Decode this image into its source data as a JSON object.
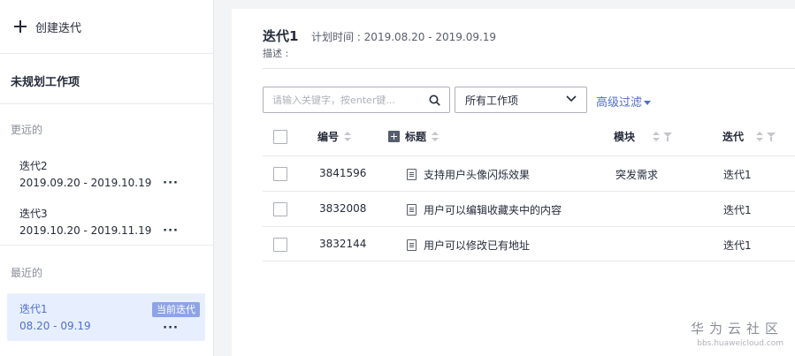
{
  "sidebar": {
    "create_label": "创建迭代",
    "unplanned_label": "未规划工作项",
    "farther_label": "更远的",
    "recent_label": "最近的",
    "farther_items": [
      {
        "name": "迭代2",
        "date": "2019.09.20 - 2019.10.19",
        "more": "···"
      },
      {
        "name": "迭代3",
        "date": "2019.10.20 - 2019.11.19",
        "more": "···"
      }
    ],
    "recent_items": [
      {
        "name": "迭代1",
        "date": "08.20 - 09.19",
        "more": "···",
        "badge": "当前迭代"
      }
    ]
  },
  "main": {
    "title": "迭代1",
    "plan_time": "计划时间 : 2019.08.20 - 2019.09.19",
    "description": "描述 :",
    "search_placeholder": "请输入关键字，按enter键...",
    "select_value": "所有工作项",
    "advanced_filter": "高级过滤",
    "columns": {
      "id": "编号",
      "title": "标题",
      "module": "模块",
      "iteration": "迭代"
    },
    "rows": [
      {
        "id": "3841596",
        "title": "支持用户头像闪烁效果",
        "module": "突发需求",
        "iteration": "迭代1"
      },
      {
        "id": "3832008",
        "title": "用户可以编辑收藏夹中的内容",
        "module": "",
        "iteration": "迭代1"
      },
      {
        "id": "3832144",
        "title": "用户可以修改已有地址",
        "module": "",
        "iteration": "迭代1"
      }
    ]
  },
  "watermark": {
    "brand": "华为云社区",
    "url": "bbs.huaweicloud.com"
  },
  "colors": {
    "accent": "#526ecc",
    "badge": "#8ea3e6",
    "current_bg": "#e7efff"
  }
}
